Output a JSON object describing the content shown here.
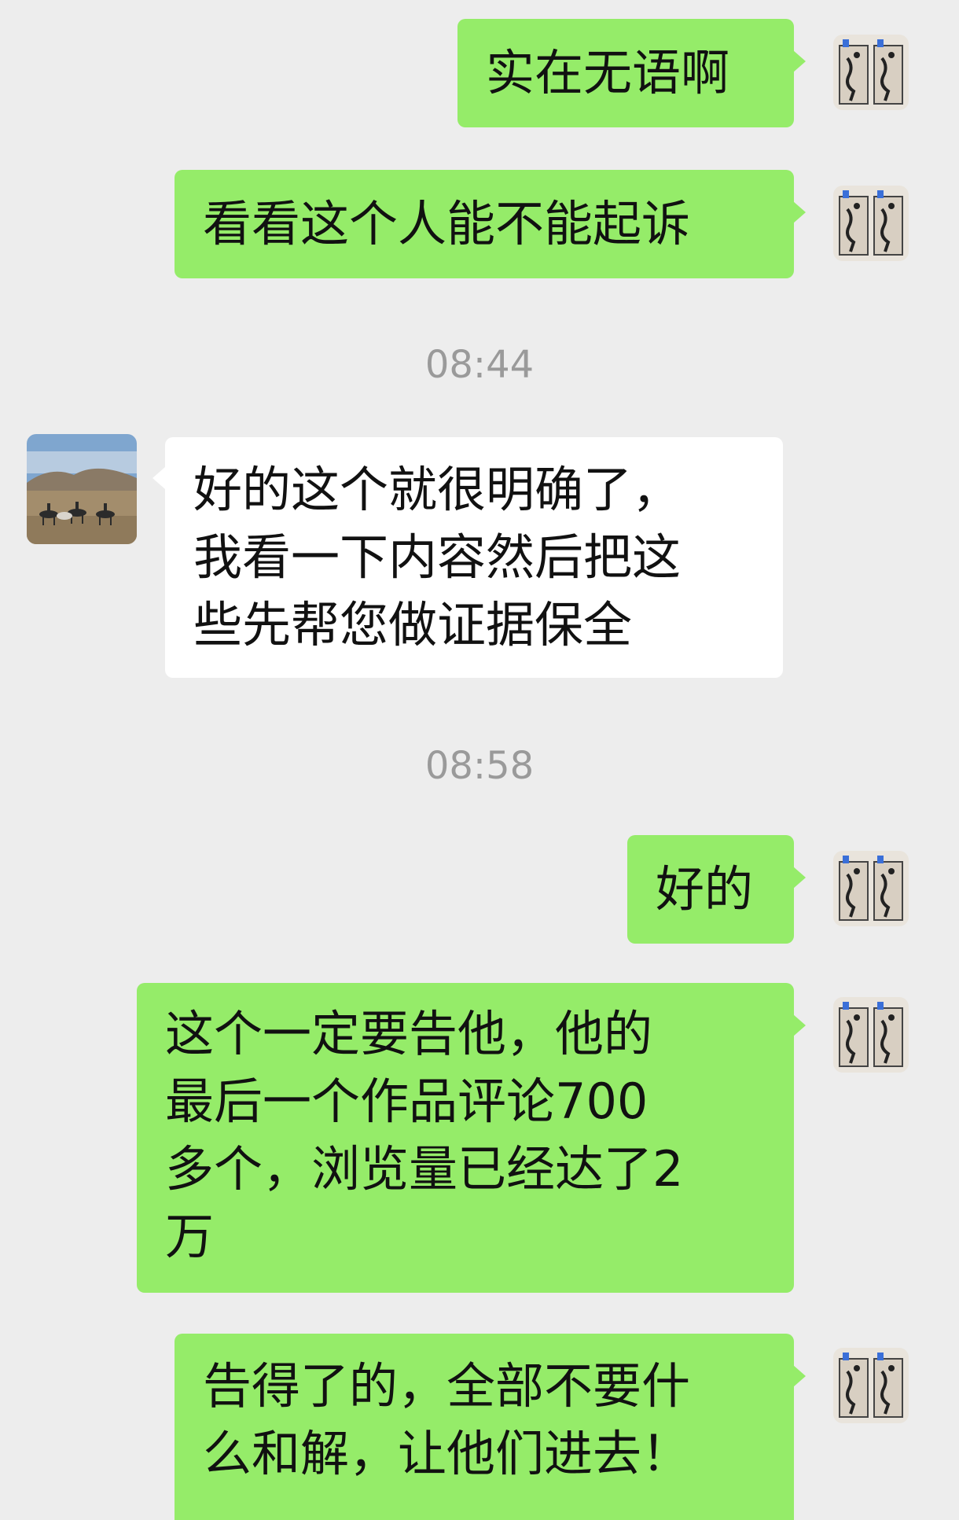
{
  "chat": {
    "messages": [
      {
        "side": "right",
        "text": "实在无语啊"
      },
      {
        "side": "right",
        "text": "看看这个人能不能起诉"
      },
      {
        "type": "time",
        "text": "08:44"
      },
      {
        "side": "left",
        "text": "好的这个就很明确了，\n我看一下内容然后把这\n些先帮您做证据保全"
      },
      {
        "type": "time",
        "text": "08:58"
      },
      {
        "side": "right",
        "text": "好的"
      },
      {
        "side": "right",
        "text": "这个一定要告他，他的\n最后一个作品评论700\n多个，浏览量已经达了2\n万"
      },
      {
        "side": "right",
        "text": "告得了的，全部不要什\n么和解，让他们进去！"
      }
    ],
    "colors": {
      "background": "#ededed",
      "sent_bubble": "#95ec69",
      "received_bubble": "#ffffff",
      "timestamp": "#9a9a9a"
    },
    "icons": {
      "self_avatar": "sketch-figures-avatar",
      "contact_avatar": "horse-riders-landscape-avatar"
    }
  }
}
